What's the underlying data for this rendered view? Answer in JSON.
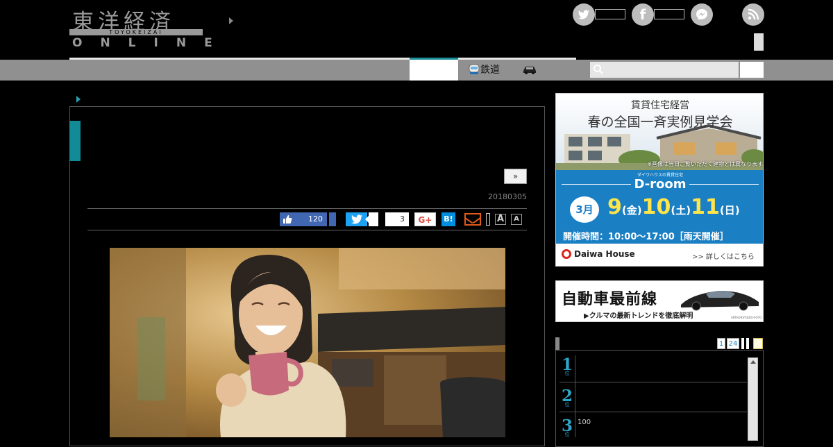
{
  "header": {
    "logo_main": "東洋経済",
    "logo_sub": "TOYOKEIZAI",
    "logo_online": "ONLINE",
    "social_icons": [
      "twitter-icon",
      "facebook-icon",
      "messenger-icon",
      "rss-icon"
    ]
  },
  "nav": {
    "items": [
      {
        "label": "",
        "active": true
      },
      {
        "label": "鉄道",
        "icon": "train-icon"
      },
      {
        "label": "",
        "icon": "car-icon"
      }
    ],
    "search_placeholder": ""
  },
  "article": {
    "next_label": "»",
    "date": "20180305",
    "share": {
      "facebook_like_count": "120",
      "pocket_count": "3",
      "gplus_label": "G+",
      "hatena_label": "B!",
      "font_large_label": "A",
      "font_small_label": "A"
    }
  },
  "ads": {
    "daiwa": {
      "heading": "賃貸住宅経営",
      "title": "春の全国一斉実例見学会",
      "disclaimer": "※画像は当日ご覧いただく建物とは異なります",
      "brand_small": "ダイワハウスの賃貸住宅",
      "brand": "D-room",
      "month": "3月",
      "day1": "9",
      "dow1": "金",
      "day2": "10",
      "dow2": "土",
      "day3": "11",
      "dow3": "日",
      "hours": "開催時間：10:00〜17:00［雨天開催］",
      "company": "Daiwa House",
      "link": ">> 詳しくはこちら"
    },
    "car": {
      "title": "自動車最前線",
      "subtitle": "▶クルマの最新トレンドを徹底解明",
      "credit": "ARTHURSTUDIO-FOTO"
    }
  },
  "ranking": {
    "tabs": [
      "1",
      "24"
    ],
    "items": [
      {
        "rank": "1",
        "suffix": "位",
        "text": ""
      },
      {
        "rank": "2",
        "suffix": "位",
        "text": ""
      },
      {
        "rank": "3",
        "suffix": "位",
        "text": "100"
      }
    ]
  },
  "colors": {
    "accent": "#138b96",
    "facebook": "#4267b2",
    "twitter": "#1da1f2",
    "hatena": "#008fde",
    "daiwa_blue": "#1b7fc4",
    "rank_blue": "#2ea6c8"
  }
}
